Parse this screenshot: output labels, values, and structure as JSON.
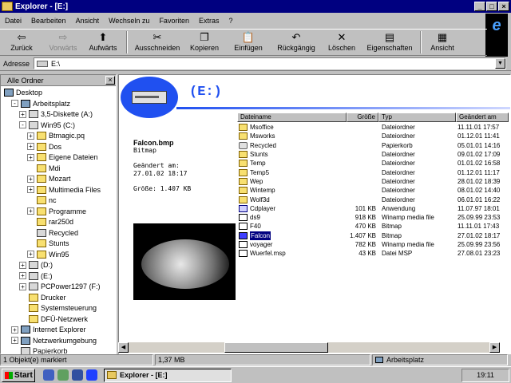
{
  "window": {
    "title": "Explorer - [E:]"
  },
  "menu": [
    "Datei",
    "Bearbeiten",
    "Ansicht",
    "Wechseln zu",
    "Favoriten",
    "Extras",
    "?"
  ],
  "toolbar": [
    {
      "label": "Zurück",
      "icon": "back-arrow-icon",
      "glyph": "⇦",
      "enabled": true
    },
    {
      "label": "Vorwärts",
      "icon": "forward-arrow-icon",
      "glyph": "⇨",
      "enabled": false
    },
    {
      "label": "Aufwärts",
      "icon": "up-folder-icon",
      "glyph": "⬆",
      "enabled": true
    },
    {
      "label": "Ausschneiden",
      "icon": "scissors-icon",
      "glyph": "✂",
      "enabled": true
    },
    {
      "label": "Kopieren",
      "icon": "copy-icon",
      "glyph": "❐",
      "enabled": true
    },
    {
      "label": "Einfügen",
      "icon": "paste-icon",
      "glyph": "📋",
      "enabled": true
    },
    {
      "label": "Rückgängig",
      "icon": "undo-icon",
      "glyph": "↶",
      "enabled": true
    },
    {
      "label": "Löschen",
      "icon": "delete-icon",
      "glyph": "✕",
      "enabled": true
    },
    {
      "label": "Eigenschaften",
      "icon": "properties-icon",
      "glyph": "▤",
      "enabled": true
    },
    {
      "label": "Ansicht",
      "icon": "view-icon",
      "glyph": "▦",
      "enabled": true
    }
  ],
  "address": {
    "label": "Adresse",
    "value": "E:\\"
  },
  "tree": {
    "header": "Alle Ordner",
    "items": [
      {
        "label": "Desktop",
        "icon": "desktop",
        "level": 0
      },
      {
        "label": "Arbeitsplatz",
        "icon": "computer",
        "level": 1,
        "toggle": "-"
      },
      {
        "label": "3,5-Diskette (A:)",
        "icon": "drive",
        "level": 2,
        "toggle": "+"
      },
      {
        "label": "Win95 (C:)",
        "icon": "drive",
        "level": 2,
        "toggle": "-"
      },
      {
        "label": "Btmagic.pq",
        "icon": "folder",
        "level": 3,
        "toggle": "+"
      },
      {
        "label": "Dos",
        "icon": "folder",
        "level": 3,
        "toggle": "+"
      },
      {
        "label": "Eigene Dateien",
        "icon": "folder",
        "level": 3,
        "toggle": "+"
      },
      {
        "label": "Mdi",
        "icon": "folder",
        "level": 3
      },
      {
        "label": "Mozart",
        "icon": "folder",
        "level": 3,
        "toggle": "+"
      },
      {
        "label": "Multimedia Files",
        "icon": "folder",
        "level": 3,
        "toggle": "+"
      },
      {
        "label": "nc",
        "icon": "folder",
        "level": 3
      },
      {
        "label": "Programme",
        "icon": "folder",
        "level": 3,
        "toggle": "+"
      },
      {
        "label": "rar250d",
        "icon": "folder",
        "level": 3
      },
      {
        "label": "Recycled",
        "icon": "recycle",
        "level": 3
      },
      {
        "label": "Stunts",
        "icon": "folder",
        "level": 3
      },
      {
        "label": "Win95",
        "icon": "folder",
        "level": 3,
        "toggle": "+"
      },
      {
        "label": "(D:)",
        "icon": "drive",
        "level": 2,
        "toggle": "+"
      },
      {
        "label": "(E:)",
        "icon": "drive",
        "level": 2,
        "toggle": "+"
      },
      {
        "label": "PCPower1297 (F:)",
        "icon": "drive",
        "level": 2,
        "toggle": "+"
      },
      {
        "label": "Drucker",
        "icon": "folder",
        "level": 2
      },
      {
        "label": "Systemsteuerung",
        "icon": "folder",
        "level": 2
      },
      {
        "label": "DFÜ-Netzwerk",
        "icon": "folder",
        "level": 2
      },
      {
        "label": "Internet Explorer",
        "icon": "computer",
        "level": 1,
        "toggle": "+"
      },
      {
        "label": "Netzwerkumgebung",
        "icon": "computer",
        "level": 1,
        "toggle": "+"
      },
      {
        "label": "Papierkorb",
        "icon": "recycle",
        "level": 1
      }
    ]
  },
  "drive_title": "(E:)",
  "details": {
    "filename": "Falcon.bmp",
    "type": "Bitmap",
    "modified_label": "Geändert am:",
    "modified": "27.01.02 18:17",
    "size_label": "Größe: 1.407 KB"
  },
  "columns": [
    "Dateiname",
    "Größe",
    "Typ",
    "Geändert am"
  ],
  "files": [
    {
      "name": "Msoffice",
      "size": "",
      "type": "Dateiordner",
      "date": "11.11.01 17:57",
      "icon": "folder"
    },
    {
      "name": "Msworks",
      "size": "",
      "type": "Dateiordner",
      "date": "01.12.01 11:41",
      "icon": "folder"
    },
    {
      "name": "Recycled",
      "size": "",
      "type": "Papierkorb",
      "date": "05.01.01 14:16",
      "icon": "rec"
    },
    {
      "name": "Stunts",
      "size": "",
      "type": "Dateiordner",
      "date": "09.01.02 17:09",
      "icon": "folder"
    },
    {
      "name": "Temp",
      "size": "",
      "type": "Dateiordner",
      "date": "01.01.02 16:58",
      "icon": "folder"
    },
    {
      "name": "Temp5",
      "size": "",
      "type": "Dateiordner",
      "date": "01.12.01 11:17",
      "icon": "folder"
    },
    {
      "name": "Wep",
      "size": "",
      "type": "Dateiordner",
      "date": "28.01.02 18:39",
      "icon": "folder"
    },
    {
      "name": "Wintemp",
      "size": "",
      "type": "Dateiordner",
      "date": "08.01.02 14:40",
      "icon": "folder"
    },
    {
      "name": "Wolf3d",
      "size": "",
      "type": "Dateiordner",
      "date": "06.01.01 16:22",
      "icon": "folder"
    },
    {
      "name": "Cdplayer",
      "size": "101 KB",
      "type": "Anwendung",
      "date": "11.07.97 18:01",
      "icon": "app"
    },
    {
      "name": "ds9",
      "size": "918 KB",
      "type": "Winamp media file",
      "date": "25.09.99 23:53",
      "icon": "bmp"
    },
    {
      "name": "F40",
      "size": "470 KB",
      "type": "Bitmap",
      "date": "11.11.01 17:43",
      "icon": "bmp"
    },
    {
      "name": "Falcon",
      "size": "1.407 KB",
      "type": "Bitmap",
      "date": "27.01.02 18:17",
      "icon": "sel",
      "selected": true
    },
    {
      "name": "voyager",
      "size": "782 KB",
      "type": "Winamp media file",
      "date": "25.09.99 23:56",
      "icon": "bmp"
    },
    {
      "name": "Wuerfel.msp",
      "size": "43 KB",
      "type": "Datei MSP",
      "date": "27.08.01 23:23",
      "icon": "bmp"
    }
  ],
  "status": {
    "count": "1 Objekt(e) markiert",
    "size": "1,37 MB",
    "location": "Arbeitsplatz"
  },
  "taskbar": {
    "start": "Start",
    "task": "Explorer - [E:]",
    "clock": "19:11"
  }
}
